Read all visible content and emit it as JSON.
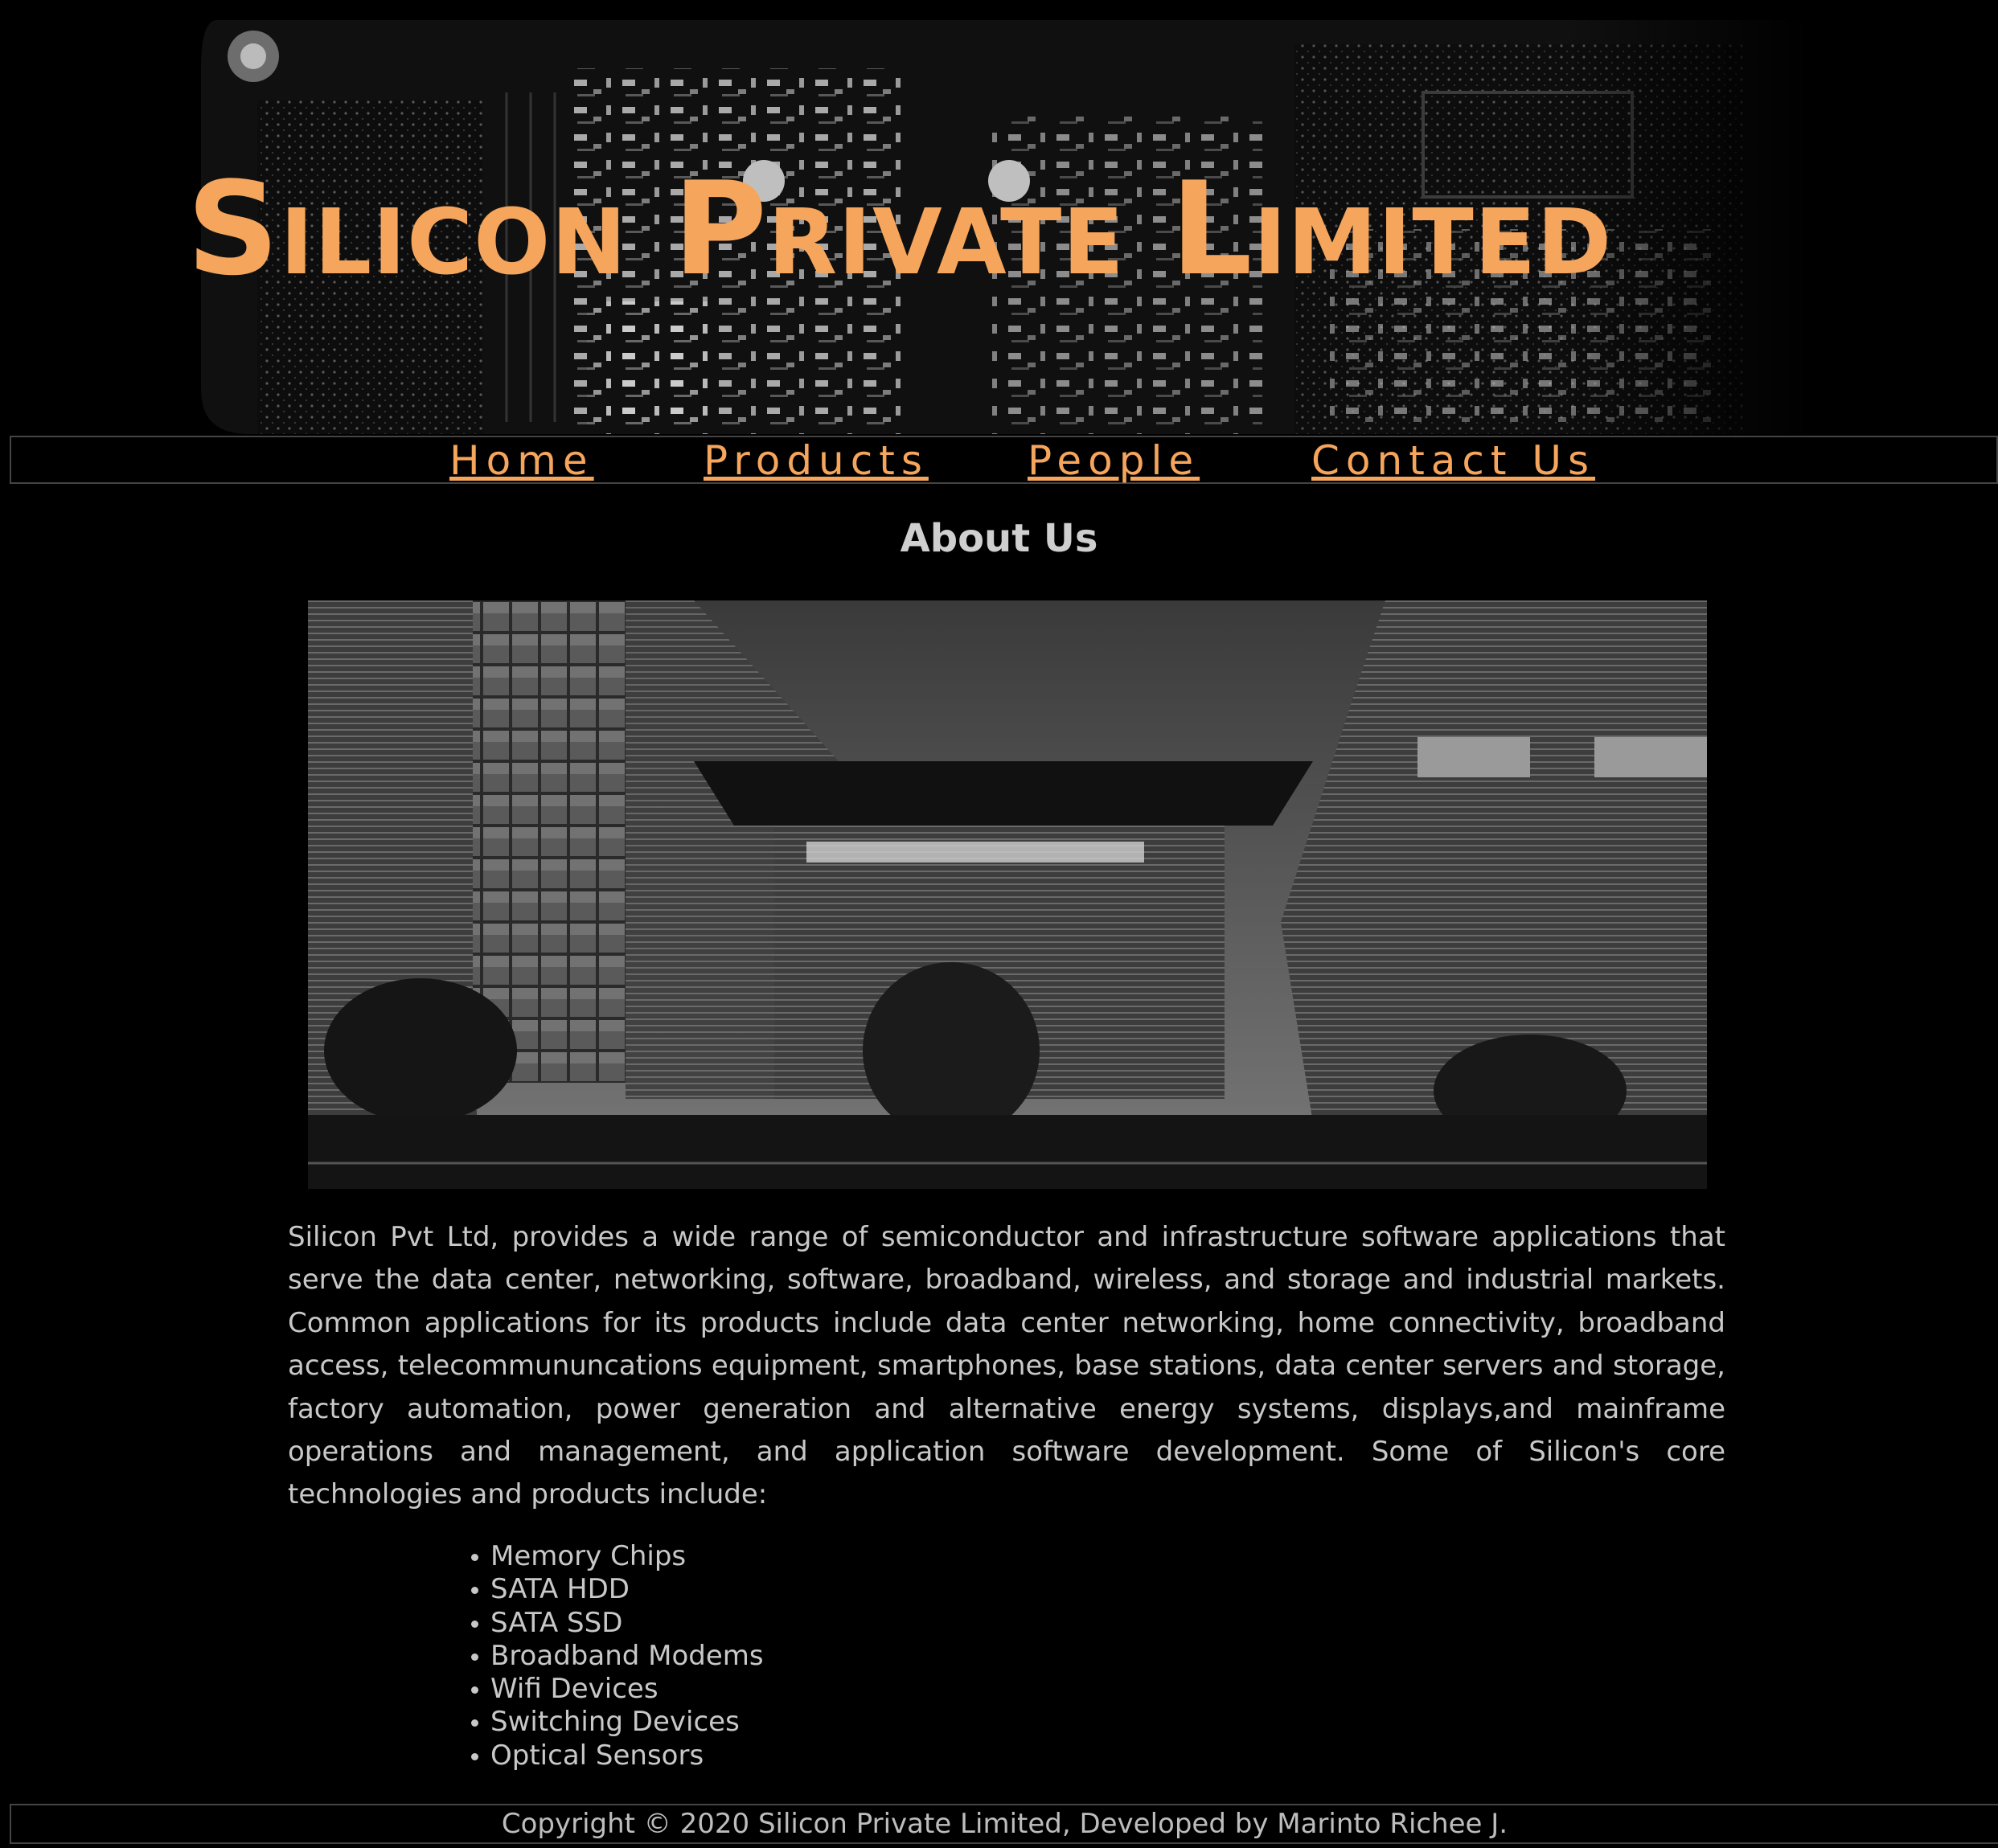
{
  "header": {
    "title": "Silicon Private Limited",
    "title_color": "#f6a65c",
    "banner_image": "circuit-board-photo"
  },
  "nav": {
    "items": [
      {
        "label": "Home"
      },
      {
        "label": "Products"
      },
      {
        "label": "People"
      },
      {
        "label": "Contact Us"
      }
    ],
    "link_color": "#f6a65c"
  },
  "about": {
    "heading": "About Us",
    "image": "office-building-photo",
    "paragraph": "Silicon Pvt Ltd, provides a wide range of semiconductor and infrastructure software applications that serve the data center, networking, software, broadband, wireless, and storage and industrial markets. Common applications for its products include data center networking, home connectivity, broadband access, telecommununcations equipment, smartphones, base stations, data center servers and storage, factory automation, power generation and alternative energy systems, displays,and mainframe operations and management, and application software development. Some of Silicon's core technologies and products include:",
    "products": [
      "Memory Chips",
      "SATA HDD",
      "SATA SSD",
      "Broadband Modems",
      "Wifi Devices",
      "Switching Devices",
      "Optical Sensors"
    ]
  },
  "footer": {
    "copyright": "Copyright © 2020 Silicon Private Limited, Developed by Marinto Richee J."
  }
}
